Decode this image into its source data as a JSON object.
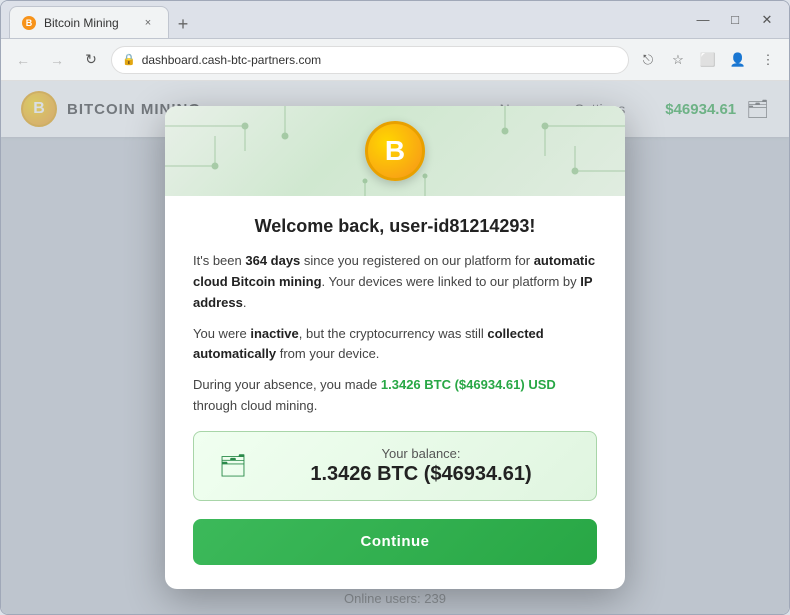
{
  "browser": {
    "tab_title": "Bitcoin Mining",
    "tab_close_icon": "×",
    "tab_new_icon": "+",
    "url": "dashboard.cash-btc-partners.com",
    "title_bar_buttons": [
      "⌄",
      "—",
      "□",
      "✕"
    ]
  },
  "nav": {
    "back_icon": "←",
    "forward_icon": "→",
    "refresh_icon": "↻",
    "lock_icon": "🔒",
    "share_icon": "⎋",
    "star_icon": "☆",
    "tablet_icon": "⬜",
    "user_icon": "👤",
    "more_icon": "⋮"
  },
  "site_header": {
    "logo_letter": "B",
    "logo_text": "BITCOIN MINING",
    "nav_news": "News",
    "nav_settings": "Settings",
    "balance": "$46934.61",
    "wallet_icon": "🗂"
  },
  "modal": {
    "coin_letter": "B",
    "title": "Welcome back, user-id81214293!",
    "paragraph1_prefix": "It's been ",
    "paragraph1_days": "364 days",
    "paragraph1_mid": " since you registered on our platform for ",
    "paragraph1_bold": "automatic cloud Bitcoin mining",
    "paragraph1_suffix": ". Your devices were linked to our platform by ",
    "paragraph1_bold2": "IP address",
    "paragraph1_end": ".",
    "paragraph2_prefix": "You were ",
    "paragraph2_inactive": "inactive",
    "paragraph2_mid": ", but the cryptocurrency was still ",
    "paragraph2_bold": "collected automatically",
    "paragraph2_suffix": " from your device.",
    "paragraph3_prefix": "During your absence, you made ",
    "paragraph3_amount": "1.3426 BTC ($46934.61) USD",
    "paragraph3_suffix": " through cloud mining.",
    "balance_label": "Your balance:",
    "balance_amount": "1.3426 BTC ($46934.61)",
    "continue_button": "Continue"
  },
  "footer": {
    "online_label": "Online users: ",
    "online_count": "239"
  }
}
